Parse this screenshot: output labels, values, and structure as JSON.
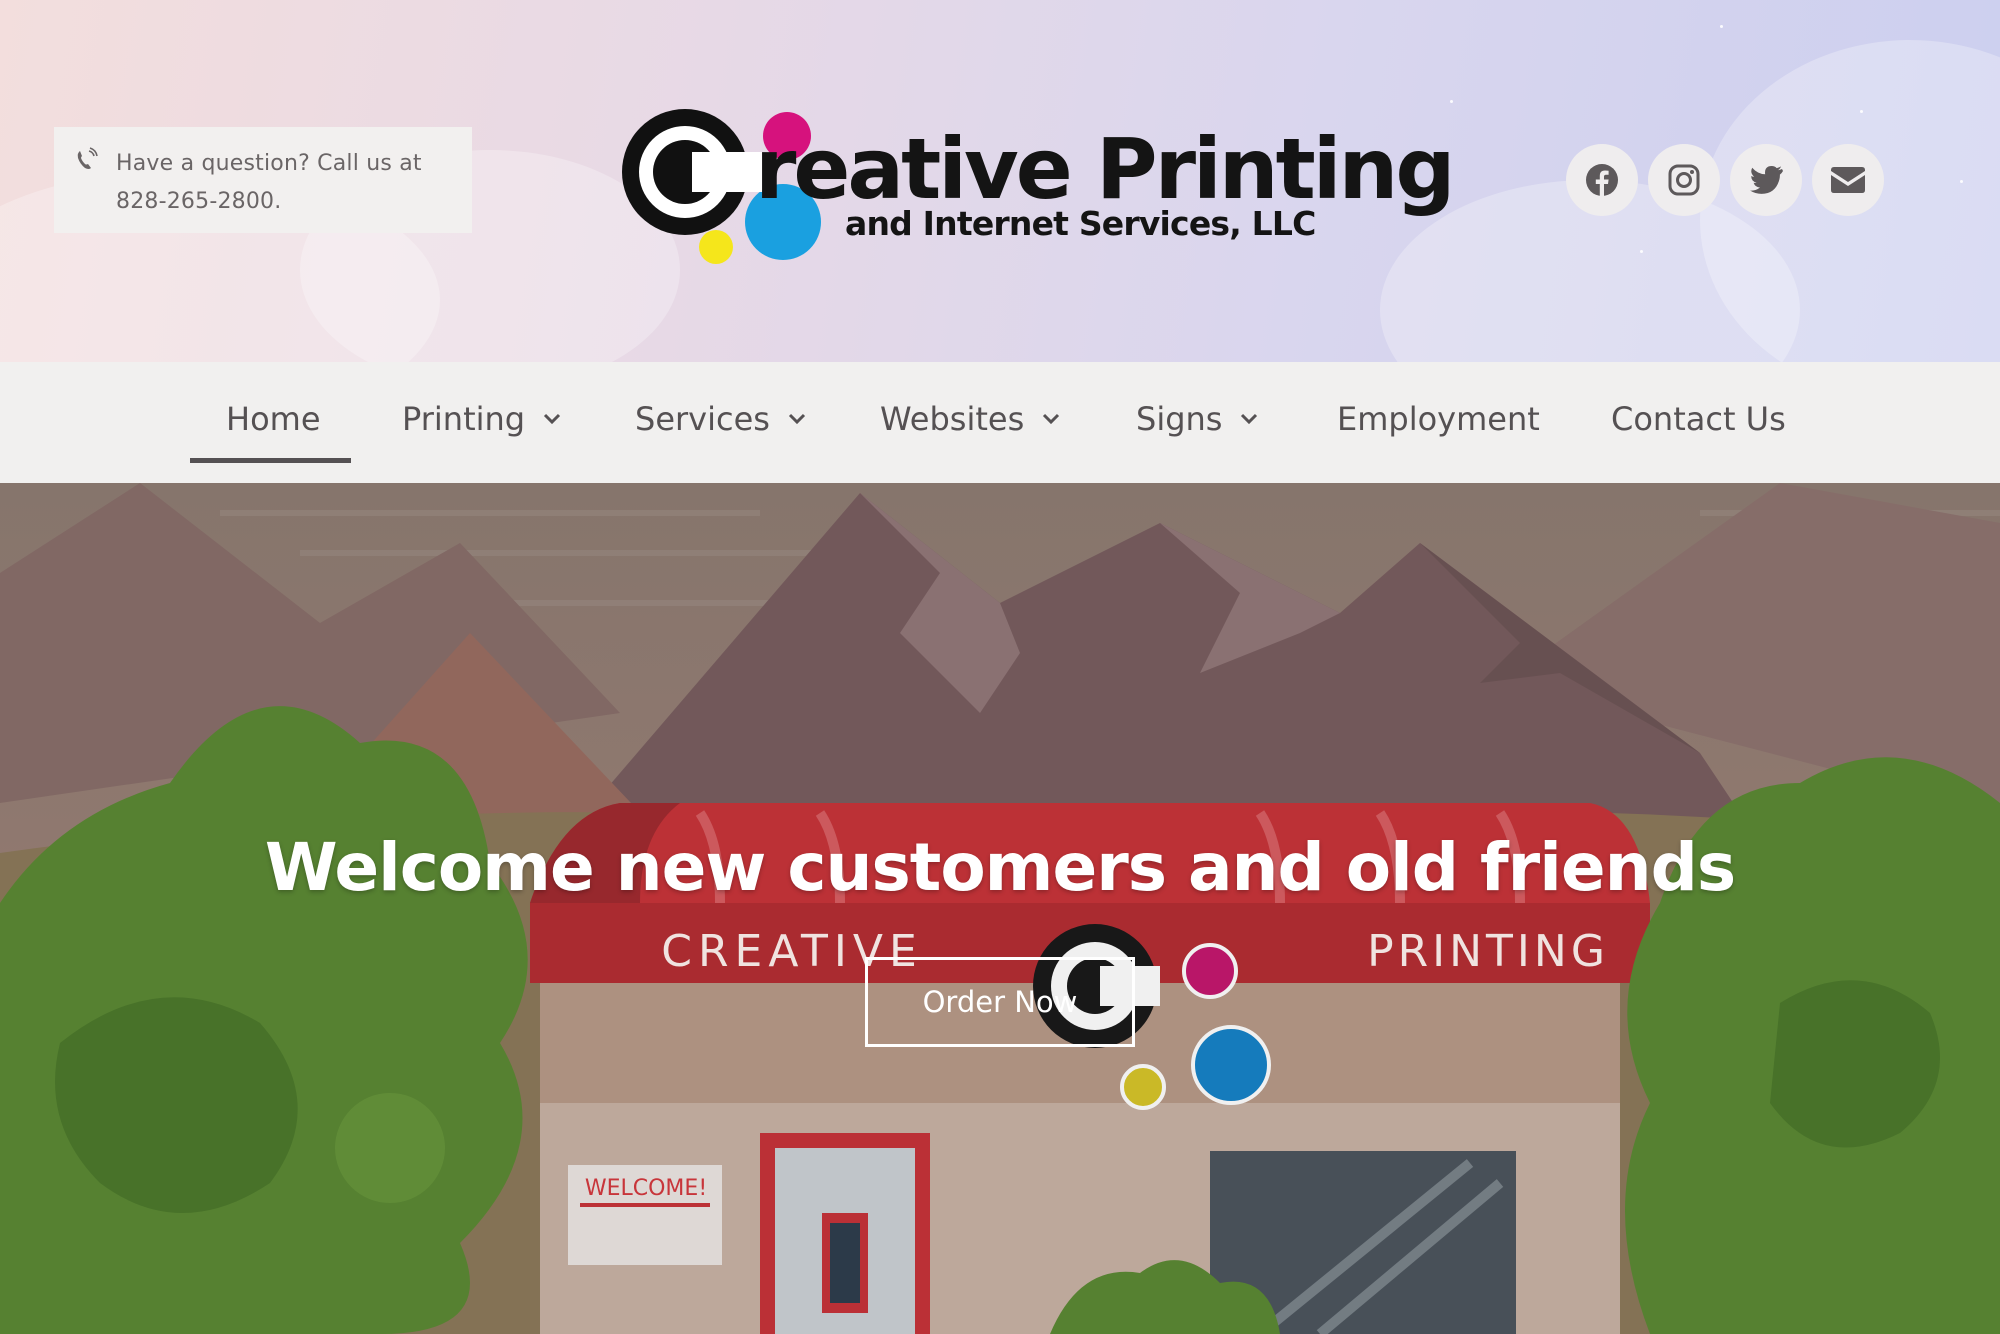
{
  "header": {
    "contact_text": "Have a question? Call us at 828-265-2800.",
    "logo_title": "reative Printing",
    "logo_subtitle": "and Internet Services, LLC",
    "social_icons": [
      "facebook-icon",
      "instagram-icon",
      "twitter-icon",
      "email-icon"
    ]
  },
  "nav": {
    "items": [
      {
        "label": "Home",
        "active": true,
        "dropdown": false
      },
      {
        "label": "Printing",
        "dropdown": true
      },
      {
        "label": "Services",
        "dropdown": true
      },
      {
        "label": "Websites",
        "dropdown": true
      },
      {
        "label": "Signs",
        "dropdown": true
      },
      {
        "label": "Employment",
        "dropdown": false
      },
      {
        "label": "Contact Us",
        "dropdown": false
      }
    ]
  },
  "hero": {
    "title": "Welcome new customers and old friends",
    "button_label": "Order Now",
    "awning_left": "CREATIVE",
    "awning_right": "PRINTING",
    "window_sign": "WELCOME!"
  },
  "colors": {
    "nav_text": "#555153",
    "nav_bg": "#f1f0ef",
    "magenta": "#d6127d",
    "cyan": "#1aa0e0",
    "yellow": "#f5e61b",
    "awning_red": "#c8353a"
  }
}
